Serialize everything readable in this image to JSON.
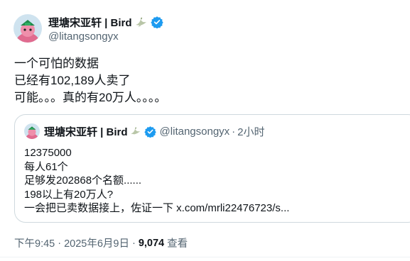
{
  "author": {
    "display_name": "理塘宋亚轩 | Bird",
    "handle": "@litangsongyx"
  },
  "post": {
    "lines": [
      "一个可怕的数据",
      "已经有102,189人卖了",
      "可能。。。真的有20万人。。。。"
    ]
  },
  "quote": {
    "display_name": "理塘宋亚轩 | Bird",
    "handle": "@litangsongyx",
    "separator": "·",
    "time": "2小时",
    "lines": [
      "12375000",
      "每人61个",
      "足够发202868个名额......",
      "198以上有20万人?",
      "一会把已卖数据接上，佐证一下 x.com/mrli22476723/s..."
    ]
  },
  "meta": {
    "time": "下午9:45",
    "separator": "·",
    "date": "2025年6月9日",
    "views_count": "9,074",
    "views_label": "查看"
  },
  "colors": {
    "text": "#0f1419",
    "secondary": "#536471",
    "verified": "#1d9bf0",
    "border": "#cfd9de"
  }
}
